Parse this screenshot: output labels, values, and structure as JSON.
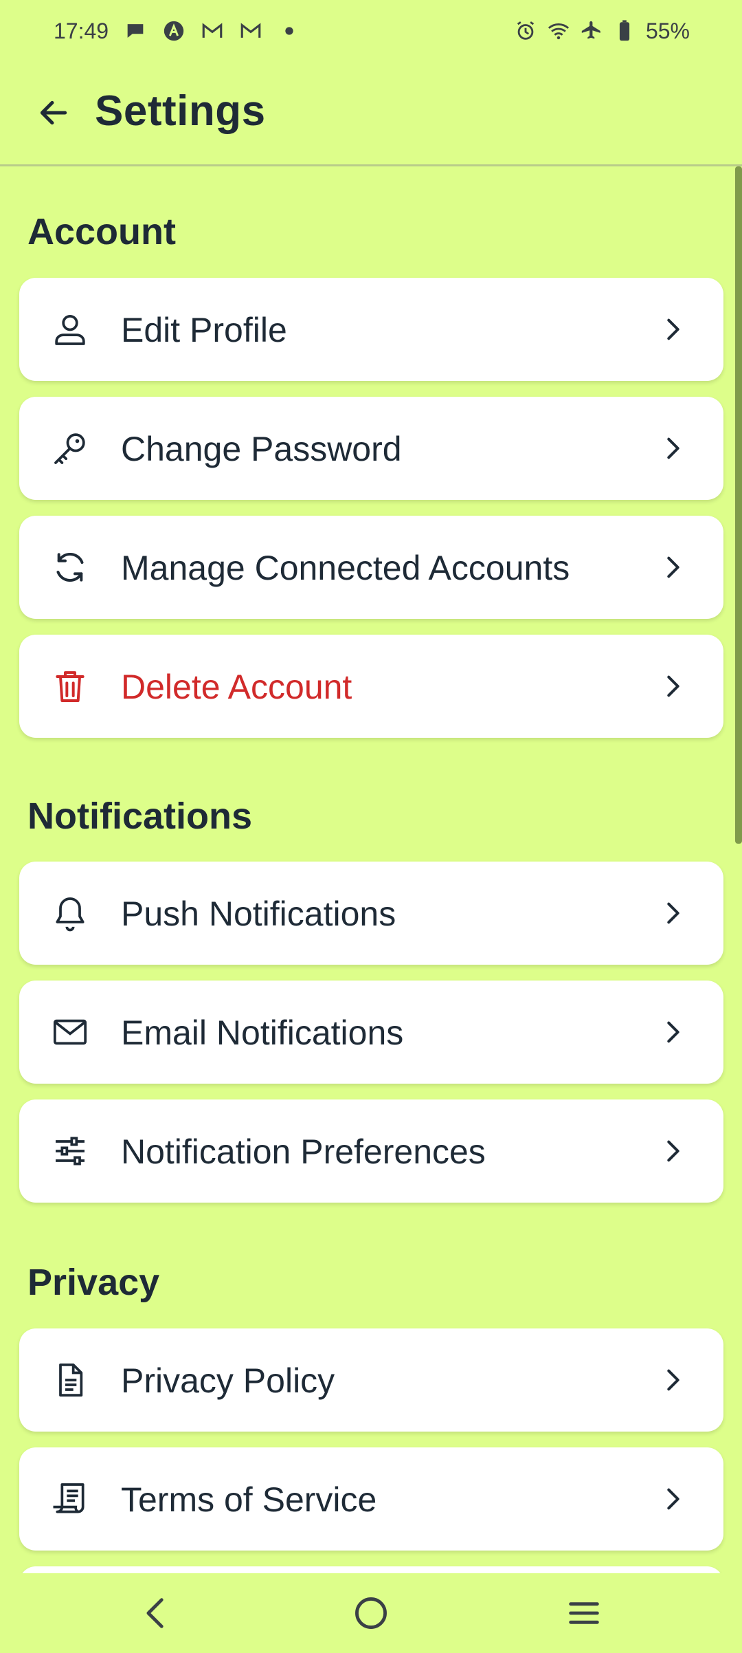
{
  "status_bar": {
    "time": "17:49",
    "battery": "55%",
    "left_icons": [
      "chat-bubble-icon",
      "app-a-icon",
      "gmail-icon",
      "gmail-icon",
      "dot-icon"
    ],
    "right_icons": [
      "alarm-icon",
      "wifi-icon",
      "airplane-icon",
      "battery-icon"
    ]
  },
  "app_bar": {
    "title": "Settings",
    "back_icon": "arrow-left-icon"
  },
  "sections": [
    {
      "title": "Account",
      "items": [
        {
          "label": "Edit Profile",
          "icon": "user-icon"
        },
        {
          "label": "Change Password",
          "icon": "key-icon"
        },
        {
          "label": "Manage Connected Accounts",
          "icon": "sync-icon"
        },
        {
          "label": "Delete Account",
          "icon": "trash-icon",
          "danger": true
        }
      ]
    },
    {
      "title": "Notifications",
      "items": [
        {
          "label": "Push Notifications",
          "icon": "bell-icon"
        },
        {
          "label": "Email Notifications",
          "icon": "mail-icon"
        },
        {
          "label": "Notification Preferences",
          "icon": "sliders-icon"
        }
      ]
    },
    {
      "title": "Privacy",
      "items": [
        {
          "label": "Privacy Policy",
          "icon": "document-icon"
        },
        {
          "label": "Terms of Service",
          "icon": "scroll-icon"
        }
      ]
    }
  ],
  "colors": {
    "background": "#DDFE8A",
    "card": "#FFFFFF",
    "text": "#1E2A36",
    "danger": "#D12A2A"
  },
  "nav_bar": {
    "icons": [
      "nav-back-icon",
      "nav-home-icon",
      "nav-menu-icon"
    ]
  }
}
